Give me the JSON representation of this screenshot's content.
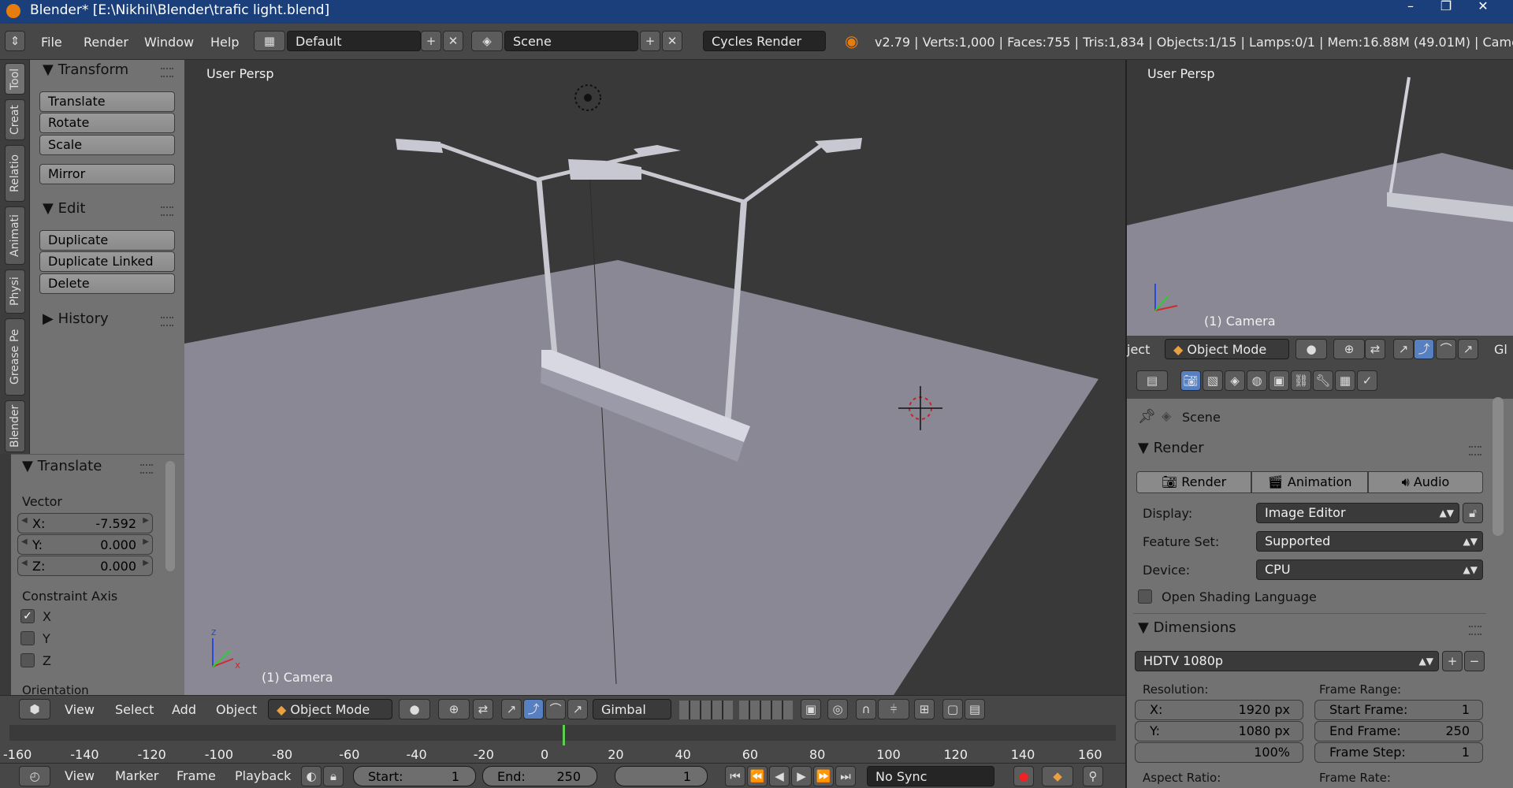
{
  "window": {
    "title": "Blender* [E:\\Nikhil\\Blender\\trafic light.blend]",
    "buttons": [
      "–",
      "❐",
      "✕"
    ]
  },
  "menubar": {
    "items": [
      "File",
      "Render",
      "Window",
      "Help"
    ],
    "layout": "Default",
    "scene": "Scene",
    "engine": "Cycles Render",
    "stats": "v2.79 | Verts:1,000 | Faces:755 | Tris:1,834 | Objects:1/15 | Lamps:0/1 | Mem:16.88M (49.01M) | Camera"
  },
  "tabs": [
    "Tool",
    "Creat",
    "Relatio",
    "Animati",
    "Physi",
    "Grease Pe",
    "Blender"
  ],
  "toolshelf": {
    "transform": {
      "title": "Transform",
      "buttons": [
        "Translate",
        "Rotate",
        "Scale",
        "Mirror"
      ]
    },
    "edit": {
      "title": "Edit",
      "buttons": [
        "Duplicate",
        "Duplicate Linked",
        "Delete"
      ]
    },
    "history": {
      "title": "History"
    }
  },
  "operator": {
    "title": "Translate",
    "vector_label": "Vector",
    "x": {
      "label": "X:",
      "value": "-7.592"
    },
    "y": {
      "label": "Y:",
      "value": "0.000"
    },
    "z": {
      "label": "Z:",
      "value": "0.000"
    },
    "constraint_label": "Constraint Axis",
    "axes": [
      {
        "label": "X",
        "checked": true
      },
      {
        "label": "Y",
        "checked": false
      },
      {
        "label": "Z",
        "checked": false
      }
    ],
    "orientation_label": "Orientation"
  },
  "viewport": {
    "label": "User Persp",
    "object": "(1) Camera"
  },
  "vp_header": {
    "menus": [
      "View",
      "Select",
      "Add",
      "Object"
    ],
    "mode": "Object Mode",
    "orientation": "Gimbal"
  },
  "timeline": {
    "ticks": [
      "-160",
      "-140",
      "-120",
      "-100",
      "-80",
      "-60",
      "-40",
      "-20",
      "0",
      "20",
      "40",
      "60",
      "80",
      "100",
      "120",
      "140",
      "160"
    ],
    "current_frame_marker": "0"
  },
  "timeline_footer": {
    "menus": [
      "View",
      "Marker",
      "Frame",
      "Playback"
    ],
    "start_label": "Start:",
    "start_value": "1",
    "end_label": "End:",
    "end_value": "250",
    "current": "1",
    "sync": "No Sync"
  },
  "camview": {
    "label": "User Persp",
    "object": "(1) Camera",
    "header_text": "ject",
    "mode": "Object Mode",
    "gl": "Gl"
  },
  "properties": {
    "context": "Scene",
    "render_title": "Render",
    "render_buttons": [
      "Render",
      "Animation",
      "Audio"
    ],
    "display_label": "Display:",
    "display_value": "Image Editor",
    "feature_label": "Feature Set:",
    "feature_value": "Supported",
    "device_label": "Device:",
    "device_value": "CPU",
    "osl_label": "Open Shading Language",
    "dimensions_title": "Dimensions",
    "preset": "HDTV 1080p",
    "resolution_label": "Resolution:",
    "res_x": {
      "label": "X:",
      "value": "1920 px"
    },
    "res_y": {
      "label": "Y:",
      "value": "1080 px"
    },
    "res_pct": "100%",
    "frame_range_label": "Frame Range:",
    "start_frame": {
      "label": "Start Frame:",
      "value": "1"
    },
    "end_frame": {
      "label": "End Frame:",
      "value": "250"
    },
    "frame_step": {
      "label": "Frame Step:",
      "value": "1"
    },
    "aspect_label": "Aspect Ratio:",
    "framerate_label": "Frame Rate:"
  },
  "colors": {
    "titlebar": "#1a3f7a",
    "header": "#474747",
    "panel": "#727272",
    "viewport_bg": "#393939",
    "ground": "#8a8895",
    "frame_marker": "#5ad14a"
  }
}
